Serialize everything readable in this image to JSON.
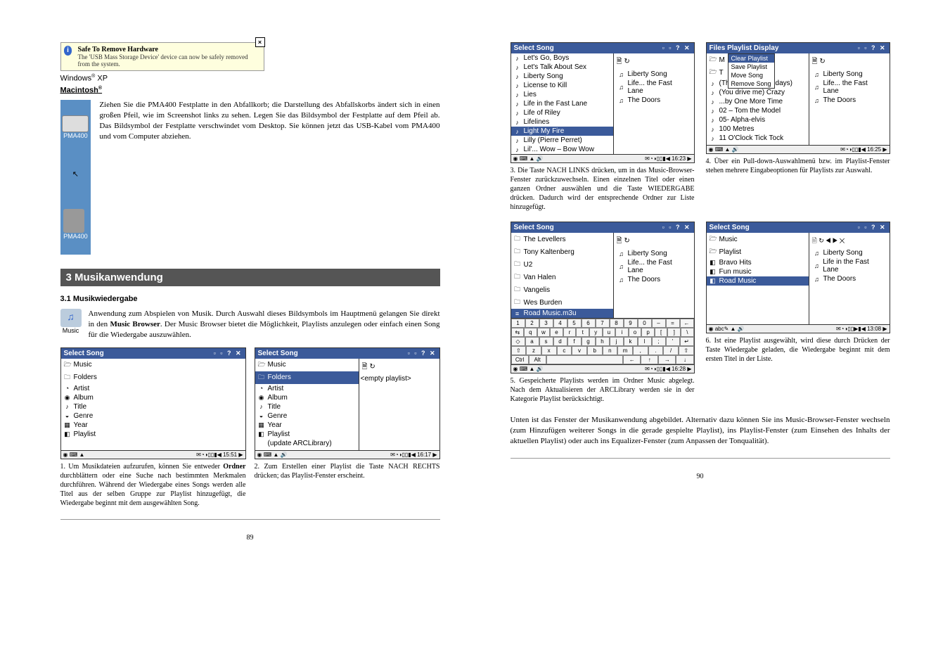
{
  "left": {
    "safe_title": "Safe To Remove Hardware",
    "safe_body": "The 'USB Mass Storage Device' device can now be safely removed from the system.",
    "winxp": "Windows",
    "winxp2": " XP",
    "mac": "Macintosh",
    "para1": "Ziehen Sie die PMA400 Festplatte in den Abfallkorb; die Darstellung des Abfallskorbs ändert sich in einen großen Pfeil, wie im Screenshot links zu sehen. Legen Sie das Bildsymbol der Festplatte auf dem Pfeil ab. Das Bildsymbol der Festplatte verschwindet vom Desktop. Sie können jetzt das USB-Kabel vom PMA400 und vom Computer abziehen.",
    "drive_lbl": "PMA400",
    "section3": "3   Musikanwendung",
    "sub31": "3.1   Musikwiedergabe",
    "music_intro": "Anwendung zum Abspielen von Musik. Durch Auswahl dieses Bildsymbols im Hauptmenü gelangen Sie direkt in den ",
    "music_browser": "Music Browser",
    "music_intro2": ". Der Music Browser bietet die Möglichkeit, Playlists anzulegen oder einfach einen Song für die Wiedergabe auszuwählen.",
    "music_lbl": "Music",
    "shot1": {
      "title": "Select Song",
      "items": [
        "Music",
        "Folders",
        "Artist",
        "Album",
        "Title",
        "Genre",
        "Year",
        "Playlist"
      ],
      "status_time": "15:51"
    },
    "shot2": {
      "title": "Select Song",
      "items": [
        "Music",
        "Folders",
        "Artist",
        "Album",
        "Title",
        "Genre",
        "Year",
        "Playlist",
        "(update ARCLibrary)"
      ],
      "right": "<empty playlist>",
      "status_time": "16:17"
    },
    "cap1a": "1. Um Musikdateien aufzurufen, können Sie entweder ",
    "cap1b": "Ordner",
    "cap1c": " durchblättern oder eine Suche nach bestimmten Merkmalen durchführen. Während der Wiedergabe eines Songs werden alle Titel aus der selben Gruppe zur Playlist hinzugefügt, die Wiedergabe beginnt mit dem ausgewählten Song.",
    "cap2": "2. Zum Erstellen einer Playlist die Taste NACH RECHTS drücken; das Playlist-Fenster erscheint.",
    "page": "89"
  },
  "right": {
    "shot3": {
      "title": "Select Song",
      "items": [
        "Let's Go, Boys",
        "Let's Talk About Sex",
        "Liberty Song",
        "License to Kill",
        "Lies",
        "Life in the Fast Lane",
        "Life of Riley",
        "Lifelines",
        "Light My Fire",
        "Lilly (Pierre Perret)",
        "Lil'... Wow – Bow Wow"
      ],
      "sel": 8,
      "right": [
        "Liberty Song",
        "Life... the Fast Lane",
        "The Doors"
      ],
      "status_time": "16:23"
    },
    "shot4": {
      "title": "Files   Playlist   Display",
      "menu_hdr": "Clear Playlist",
      "menu_items": [
        "Save Playlist",
        "Move Song",
        "Remove Song"
      ],
      "items": [
        "M",
        "T",
        "(The... for the Holidays)",
        "(You drive me) Crazy",
        "...by One More Time",
        "02 – Tom the Model",
        "05- Alpha-elvis",
        "100 Metres",
        "11 O'Clock Tick Tock"
      ],
      "right": [
        "Liberty Song",
        "Life... the Fast Lane",
        "The Doors"
      ],
      "status_time": "16:25"
    },
    "cap3": "3. Die Taste NACH LINKS drücken, um in das Music-Browser-Fenster zurückzuwechseln. Einen einzelnen Titel oder einen ganzen Ordner auswählen und die Taste WIEDERGABE drücken. Dadurch wird der entsprechende Ordner zur Liste hinzugefügt.",
    "cap4": "4. Über ein Pull-down-Auswahlmenü bzw. im Playlist-Fenster stehen mehrere Eingabeoptionen für Playlists zur Auswahl.",
    "shot5": {
      "title": "Select Song",
      "items": [
        "The Levellers",
        "Tony Kaltenberg",
        "U2",
        "Van Halen",
        "Vangelis",
        "Wes Burden",
        "Road Music.m3u"
      ],
      "sel": 6,
      "right": [
        "Liberty Song",
        "Life... the Fast Lane",
        "The Doors"
      ],
      "status_time": "16:28"
    },
    "shot6": {
      "title": "Select Song",
      "items": [
        "Music",
        "Playlist",
        "Bravo Hits",
        "Fun music",
        "Road Music"
      ],
      "sel": 4,
      "right": [
        "Liberty Song",
        "Life in the Fast Lane",
        "The Doors"
      ],
      "status_time": "13:08"
    },
    "cap5": "5. Gespeicherte Playlists werden im Ordner Music abgelegt. Nach dem Aktualisieren der ARCLibrary werden sie in der Kategorie Playlist berücksichtigt.",
    "cap6": "6. Ist eine Playlist ausgewählt, wird diese durch Drücken der Taste Wiedergabe geladen, die Wiedergabe beginnt mit dem ersten Titel in der Liste.",
    "para_bottom": "Unten ist das Fenster der Musikanwendung abgebildet. Alternativ dazu können Sie ins Music-Browser-Fenster wechseln (zum Hinzufügen weiterer Songs in die gerade gespielte Playlist), ins Playlist-Fenster (zum Einsehen des Inhalts der aktuellen Playlist) oder auch ins Equalizer-Fenster (zum Anpassen der Tonqualität).",
    "page": "90"
  }
}
